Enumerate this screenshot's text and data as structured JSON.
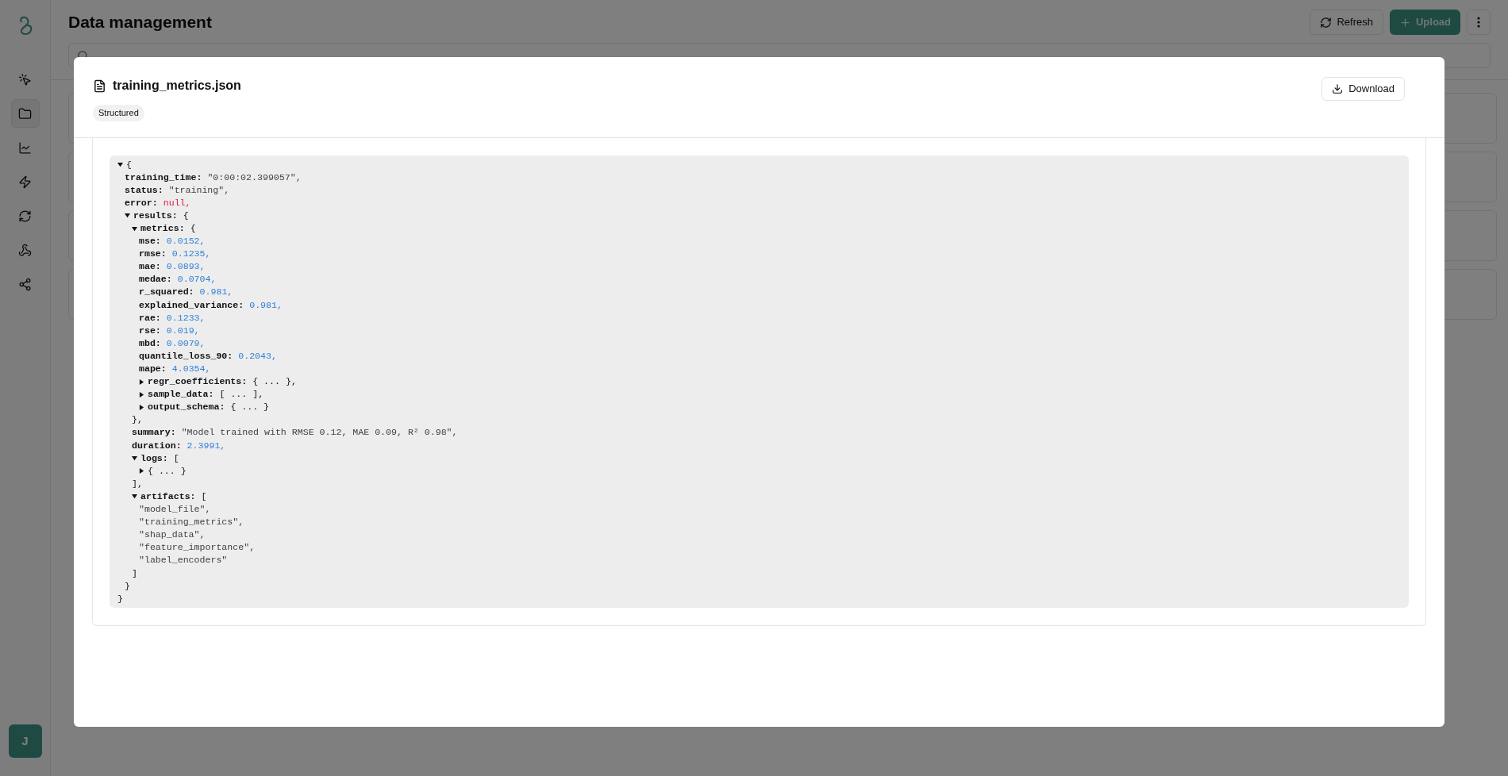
{
  "sidebar": {
    "items": [
      {
        "kind": "pointer",
        "selected": false
      },
      {
        "kind": "folder",
        "selected": true
      },
      {
        "kind": "chart",
        "selected": false
      },
      {
        "kind": "bolt",
        "selected": false
      },
      {
        "kind": "refresh",
        "selected": false
      },
      {
        "kind": "webhook",
        "selected": false
      },
      {
        "kind": "share",
        "selected": false
      }
    ],
    "avatar": "J"
  },
  "header": {
    "title": "Data management",
    "buttons": [
      {
        "kind": "refresh",
        "label": "Refresh"
      },
      {
        "kind": "upload",
        "label": "Upload"
      },
      {
        "kind": "more"
      }
    ]
  },
  "dialog": {
    "title": "training_metrics.json",
    "badge": "Structured",
    "download": "Download",
    "tree": {
      "open": "{",
      "close": "}",
      "expanded": true,
      "children": [
        {
          "kind": "string",
          "key": "training_time:",
          "value": "\"0:00:02.399057\","
        },
        {
          "kind": "string",
          "key": "status:",
          "value": "\"training\","
        },
        {
          "kind": "null",
          "key": "error:",
          "value": "null,"
        },
        {
          "kind": "object",
          "key": "results:",
          "open": "{",
          "close": "}",
          "expanded": true,
          "children": [
            {
              "kind": "object",
              "key": "metrics:",
              "open": "{",
              "close": "},",
              "expanded": true,
              "children": [
                {
                  "kind": "number",
                  "key": "mse:",
                  "value": "0.0152,"
                },
                {
                  "kind": "number",
                  "key": "rmse:",
                  "value": "0.1235,"
                },
                {
                  "kind": "number",
                  "key": "mae:",
                  "value": "0.0893,"
                },
                {
                  "kind": "number",
                  "key": "medae:",
                  "value": "0.0704,"
                },
                {
                  "kind": "number",
                  "key": "r_squared:",
                  "value": "0.981,"
                },
                {
                  "kind": "number",
                  "key": "explained_variance:",
                  "value": "0.981,"
                },
                {
                  "kind": "number",
                  "key": "rae:",
                  "value": "0.1233,"
                },
                {
                  "kind": "number",
                  "key": "rse:",
                  "value": "0.019,"
                },
                {
                  "kind": "number",
                  "key": "mbd:",
                  "value": "0.0079,"
                },
                {
                  "kind": "number",
                  "key": "quantile_loss_90:",
                  "value": "0.2043,"
                },
                {
                  "kind": "number",
                  "key": "mape:",
                  "value": "4.0354,"
                },
                {
                  "kind": "object",
                  "key": "regr_coefficients:",
                  "summary": "{ ... },",
                  "expanded": false
                },
                {
                  "kind": "array",
                  "key": "sample_data:",
                  "summary": "[ ... ],",
                  "expanded": false
                },
                {
                  "kind": "object",
                  "key": "output_schema:",
                  "summary": "{ ... }",
                  "expanded": false
                }
              ]
            },
            {
              "kind": "string",
              "key": "summary:",
              "value": "\"Model trained with RMSE 0.12, MAE 0.09, R² 0.98\","
            },
            {
              "kind": "number",
              "key": "duration:",
              "value": "2.3991,"
            },
            {
              "kind": "array",
              "key": "logs:",
              "open": "[",
              "close": "],",
              "expanded": true,
              "children": [
                {
                  "kind": "object",
                  "summary": "{ ... }",
                  "expanded": false
                }
              ]
            },
            {
              "kind": "array",
              "key": "artifacts:",
              "open": "[",
              "close": "]",
              "expanded": true,
              "children": [
                {
                  "kind": "string",
                  "value": "\"model_file\","
                },
                {
                  "kind": "string",
                  "value": "\"training_metrics\","
                },
                {
                  "kind": "string",
                  "value": "\"shap_data\","
                },
                {
                  "kind": "string",
                  "value": "\"feature_importance\","
                },
                {
                  "kind": "string",
                  "value": "\"label_encoders\""
                }
              ]
            }
          ]
        }
      ]
    }
  }
}
